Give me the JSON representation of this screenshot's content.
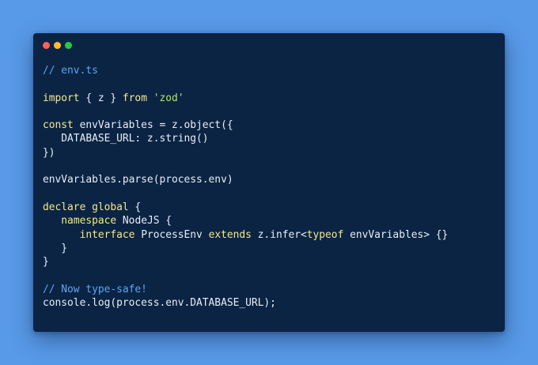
{
  "window": {
    "controls": [
      "close",
      "minimize",
      "maximize"
    ]
  },
  "colors": {
    "background": "#589AE8",
    "window": "#0B2444",
    "comment": "#5EA5F2",
    "keyword": "#F4E98A",
    "string": "#B5E26A",
    "text": "#E8EEF5"
  },
  "code": {
    "lines": [
      [
        {
          "t": "comment",
          "v": "// env.ts"
        }
      ],
      [],
      [
        {
          "t": "keyword",
          "v": "import"
        },
        {
          "t": "punc",
          "v": " { z } "
        },
        {
          "t": "keyword",
          "v": "from"
        },
        {
          "t": "punc",
          "v": " "
        },
        {
          "t": "string",
          "v": "'zod'"
        }
      ],
      [],
      [
        {
          "t": "keyword",
          "v": "const"
        },
        {
          "t": "ident",
          "v": " envVariables = z.object({"
        }
      ],
      [
        {
          "t": "prop",
          "v": "   DATABASE_URL: z.string()"
        }
      ],
      [
        {
          "t": "punc",
          "v": "})"
        }
      ],
      [],
      [
        {
          "t": "ident",
          "v": "envVariables.parse(process.env)"
        }
      ],
      [],
      [
        {
          "t": "keyword",
          "v": "declare"
        },
        {
          "t": "punc",
          "v": " "
        },
        {
          "t": "keyword",
          "v": "global"
        },
        {
          "t": "punc",
          "v": " {"
        }
      ],
      [
        {
          "t": "punc",
          "v": "   "
        },
        {
          "t": "keyword",
          "v": "namespace"
        },
        {
          "t": "type",
          "v": " NodeJS {"
        }
      ],
      [
        {
          "t": "punc",
          "v": "      "
        },
        {
          "t": "keyword",
          "v": "interface"
        },
        {
          "t": "type",
          "v": " ProcessEnv "
        },
        {
          "t": "keyword",
          "v": "extends"
        },
        {
          "t": "type",
          "v": " z.infer<"
        },
        {
          "t": "keyword",
          "v": "typeof"
        },
        {
          "t": "type",
          "v": " envVariables> {}"
        }
      ],
      [
        {
          "t": "punc",
          "v": "   }"
        }
      ],
      [
        {
          "t": "punc",
          "v": "}"
        }
      ],
      [],
      [
        {
          "t": "comment",
          "v": "// Now type-safe!"
        }
      ],
      [
        {
          "t": "ident",
          "v": "console.log(process.env.DATABASE_URL);"
        }
      ]
    ]
  }
}
